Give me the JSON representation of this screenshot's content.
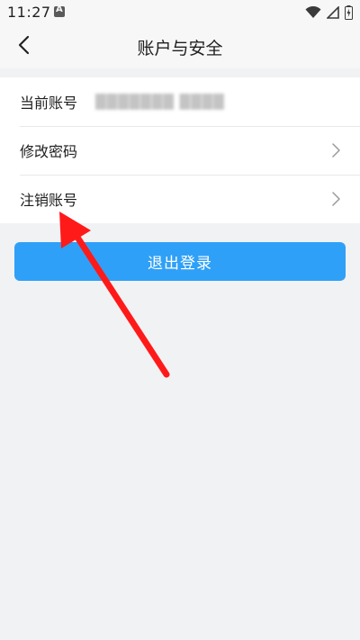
{
  "status_bar": {
    "time": "11:27"
  },
  "header": {
    "title": "账户与安全"
  },
  "settings": {
    "items": [
      {
        "label": "当前账号",
        "value": "███████ ████"
      },
      {
        "label": "修改密码"
      },
      {
        "label": "注销账号"
      }
    ]
  },
  "logout": {
    "label": "退出登录"
  },
  "colors": {
    "accent": "#2fa0f7",
    "annotation": "#ff1a1a",
    "background": "#f1f2f4"
  }
}
